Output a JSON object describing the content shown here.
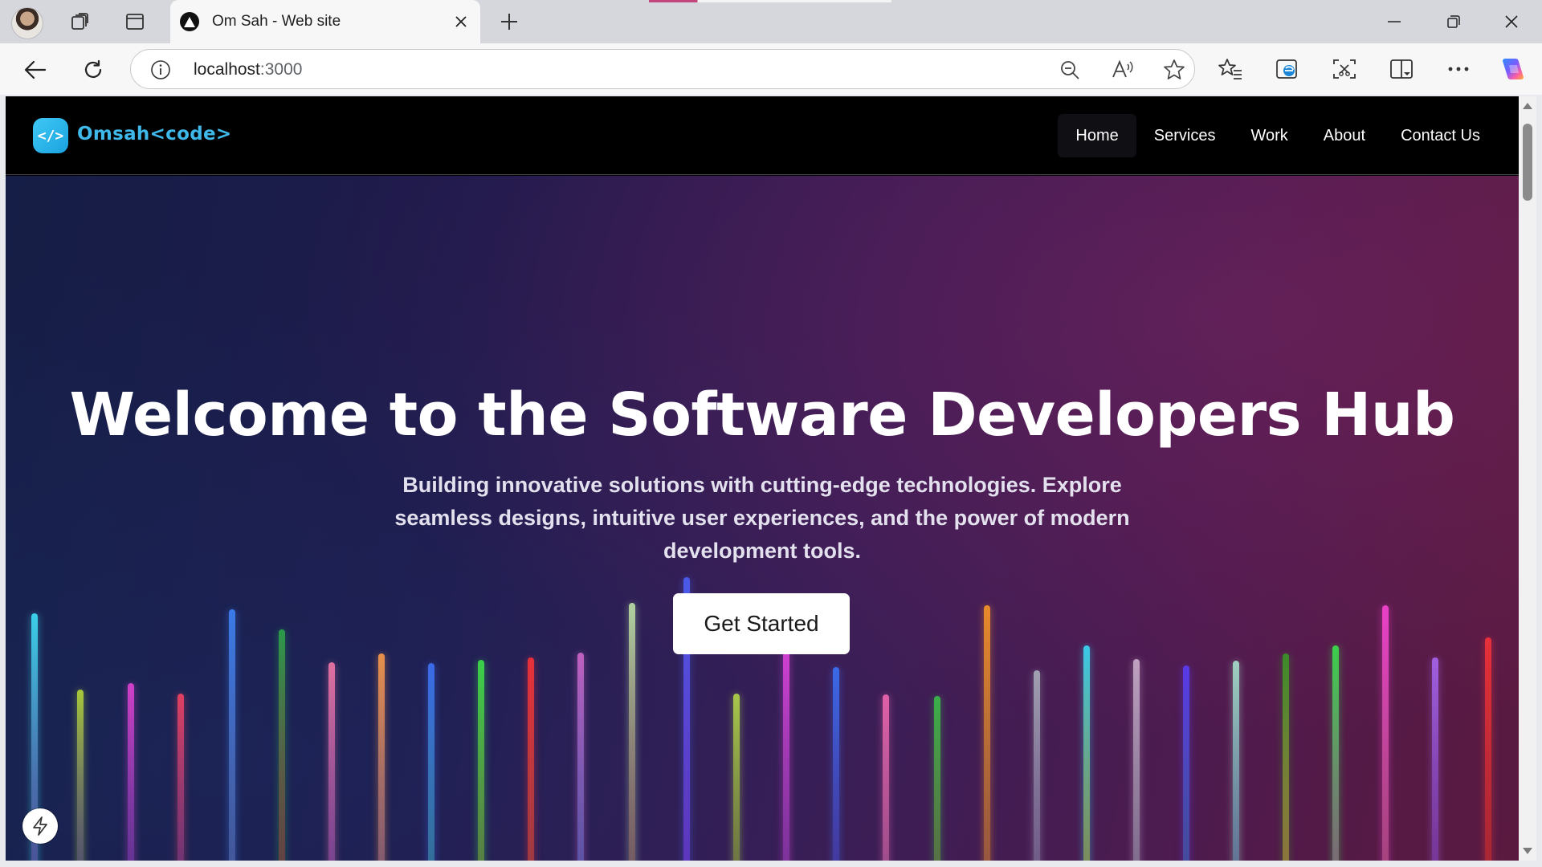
{
  "browser": {
    "tab": {
      "title": "Om Sah - Web site"
    },
    "address": {
      "host": "localhost",
      "port": ":3000"
    }
  },
  "site": {
    "logo": {
      "mark": "</>",
      "text": "Omsah<code>"
    },
    "nav": [
      {
        "label": "Home",
        "active": true
      },
      {
        "label": "Services"
      },
      {
        "label": "Work"
      },
      {
        "label": "About"
      },
      {
        "label": "Contact Us"
      }
    ],
    "hero": {
      "title": "Welcome to the Software Developers Hub",
      "subtitle": "Building innovative solutions with cutting-edge technologies. Explore seamless designs, intuitive user experiences, and the power of modern development tools.",
      "cta_label": "Get Started"
    }
  },
  "colors": {
    "accent": "#3fb8ea",
    "hero_start": "#151e46",
    "hero_end": "#5a1a40"
  },
  "icons": {
    "tab_favicon": "triangle-icon",
    "fab": "lightning-icon"
  }
}
